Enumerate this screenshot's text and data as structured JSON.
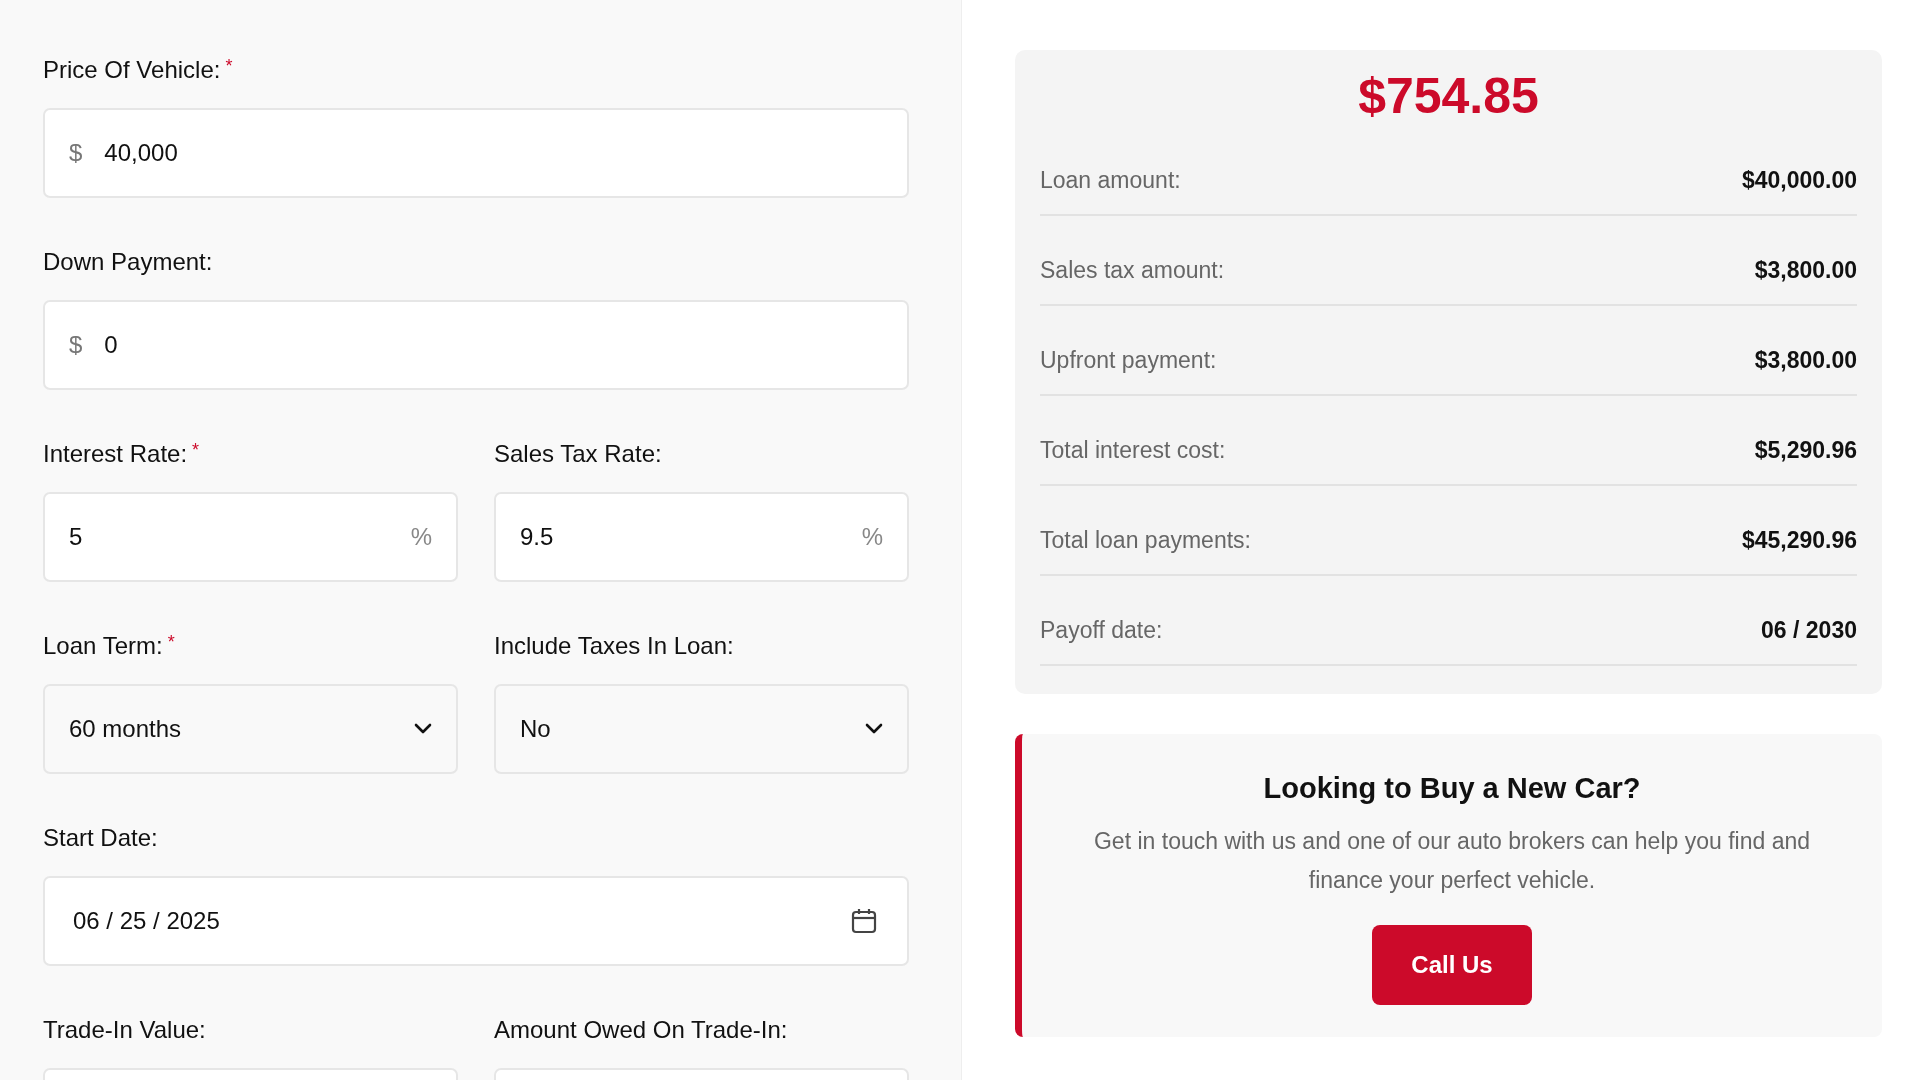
{
  "form": {
    "rows": [
      [
        {
          "label": "Price Of Vehicle:",
          "required_mark": "*",
          "kind": "currency",
          "prefix": "$",
          "value": "40,000"
        }
      ],
      [
        {
          "label": "Down Payment:",
          "kind": "currency",
          "prefix": "$",
          "value": "0"
        }
      ],
      [
        {
          "label": "Interest Rate:",
          "required_mark": "*",
          "kind": "percent",
          "suffix": "%",
          "value": "5"
        },
        {
          "label": "Sales Tax Rate:",
          "kind": "percent",
          "suffix": "%",
          "value": "9.5"
        }
      ],
      [
        {
          "label": "Loan Term:",
          "required_mark": "*",
          "kind": "select",
          "value": "60 months"
        },
        {
          "label": "Include Taxes In Loan:",
          "kind": "select",
          "value": "No"
        }
      ],
      [
        {
          "label": "Start Date:",
          "kind": "date",
          "value": "06 / 25 / 2025"
        }
      ],
      [
        {
          "label": "Trade-In Value:",
          "kind": "blank"
        },
        {
          "label": "Amount Owed On Trade-In:",
          "kind": "blank"
        }
      ]
    ]
  },
  "summary": {
    "monthly_payment": "$754.85",
    "rows": [
      {
        "label": "Loan amount:",
        "value": "$40,000.00"
      },
      {
        "label": "Sales tax amount:",
        "value": "$3,800.00"
      },
      {
        "label": "Upfront payment:",
        "value": "$3,800.00"
      },
      {
        "label": "Total interest cost:",
        "value": "$5,290.96"
      },
      {
        "label": "Total loan payments:",
        "value": "$45,290.96"
      },
      {
        "label": "Payoff date:",
        "value": "06 / 2030"
      }
    ]
  },
  "promo": {
    "title": "Looking to Buy a New Car?",
    "text": "Get in touch with us and one of our auto brokers can help you find and finance your perfect vehicle.",
    "button": "Call Us"
  }
}
